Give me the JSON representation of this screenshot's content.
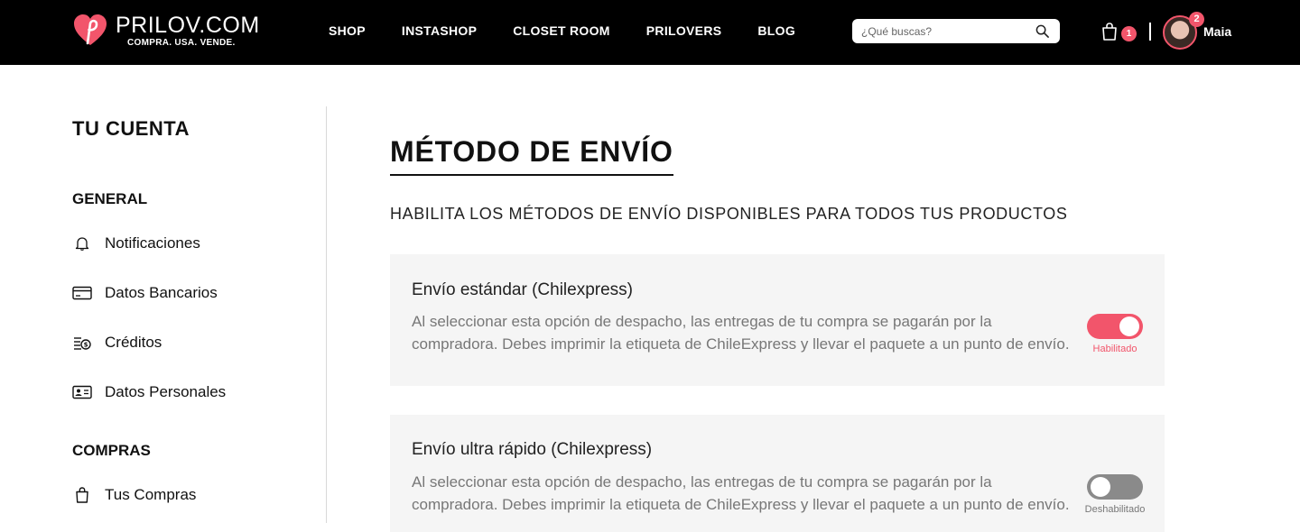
{
  "header": {
    "brand_name": "PRILOV.COM",
    "brand_tagline": "COMPRA. USA. VENDE.",
    "nav": [
      {
        "label": "SHOP"
      },
      {
        "label": "INSTASHOP"
      },
      {
        "label": "CLOSET ROOM"
      },
      {
        "label": "PRILOVERS"
      },
      {
        "label": "BLOG"
      }
    ],
    "search": {
      "placeholder": "¿Qué buscas?",
      "icon": "search-icon"
    },
    "cart_count": "1",
    "notification_count": "2",
    "user_name": "Maia",
    "accent_color": "#f2556b"
  },
  "sidebar": {
    "title": "TU CUENTA",
    "sections": [
      {
        "label": "GENERAL",
        "items": [
          {
            "label": "Notificaciones",
            "icon": "bell-icon"
          },
          {
            "label": "Datos Bancarios",
            "icon": "credit-card-icon"
          },
          {
            "label": "Créditos",
            "icon": "coins-icon"
          },
          {
            "label": "Datos Personales",
            "icon": "id-card-icon"
          }
        ]
      },
      {
        "label": "COMPRAS",
        "items": [
          {
            "label": "Tus Compras",
            "icon": "shopping-bag-icon"
          }
        ]
      }
    ]
  },
  "main": {
    "title": "MÉTODO DE ENVÍO",
    "subtitle": "HABILITA LOS MÉTODOS DE ENVÍO DISPONIBLES PARA TODOS TUS PRODUCTOS",
    "methods": [
      {
        "title": "Envío estándar (Chilexpress)",
        "description": "Al seleccionar esta opción de despacho, las entregas de tu compra se pagarán por la compradora. Debes imprimir la etiqueta de ChileExpress y llevar el paquete a un punto de envío.",
        "enabled": true,
        "status_label": "Habilitado"
      },
      {
        "title": "Envío ultra rápido (Chilexpress)",
        "description": "Al seleccionar esta opción de despacho, las entregas de tu compra se pagarán por la compradora. Debes imprimir la etiqueta de ChileExpress y llevar el paquete a un punto de envío.",
        "enabled": false,
        "status_label": "Deshabilitado"
      }
    ]
  }
}
